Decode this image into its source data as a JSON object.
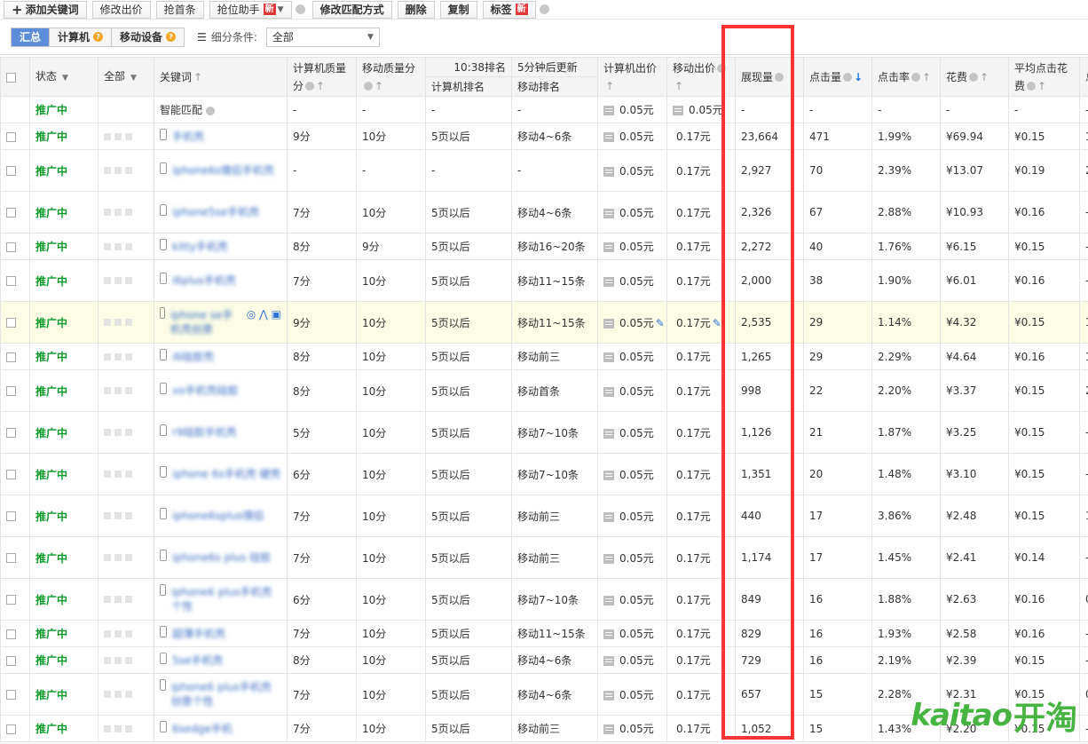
{
  "toolbar": {
    "add_keyword": "添加关键词",
    "modify_bid": "修改出价",
    "grab_first": "抢首条",
    "rank_helper": "抢位助手",
    "new_badge": "新",
    "modify_match": "修改匹配方式",
    "delete": "删除",
    "copy": "复制",
    "tag": "标签"
  },
  "filter": {
    "tabs": [
      "汇总",
      "计算机",
      "移动设备"
    ],
    "condition_label": "细分条件:",
    "condition_value": "全部"
  },
  "headers": {
    "status": "状态",
    "all": "全部",
    "keyword": "关键词",
    "pc_quality": "计算机质量分",
    "mobile_quality": "移动质量分",
    "rank_time": "10:38排名",
    "update_note": "5分钟后更新",
    "pc_rank": "计算机排名",
    "mobile_rank": "移动排名",
    "pc_bid": "计算机出价",
    "mobile_bid": "移动出价",
    "impressions": "展现量",
    "clicks": "点击量",
    "ctr": "点击率",
    "cost": "花费",
    "avg_cpc": "平均点击花费",
    "extra": "总"
  },
  "smart_row": {
    "status": "推广中",
    "keyword": "智能匹配",
    "pc_quality": "-",
    "mobile_quality": "-",
    "pc_rank": "-",
    "mobile_rank": "-",
    "pc_bid": "0.05元",
    "mobile_bid": "0.05元",
    "impressions": "-",
    "clicks": "-",
    "ctr": "-",
    "cost": "-",
    "avg_cpc": "-",
    "extra": "-"
  },
  "rows": [
    {
      "status": "推广中",
      "keyword": "手机壳",
      "pcq": "9分",
      "mq": "10分",
      "pcr": "5页以后",
      "mr": "移动4~6条",
      "pcb": "0.05元",
      "mb": "0.17元",
      "imp": "23,664",
      "clk": "471",
      "ctr": "1.99%",
      "cost": "¥69.94",
      "cpc": "¥0.15",
      "ex": "1"
    },
    {
      "status": "推广中",
      "keyword": "iphone6s情侣手机壳",
      "pcq": "-",
      "mq": "-",
      "pcr": "-",
      "mr": "-",
      "pcb": "0.05元",
      "mb": "0.17元",
      "imp": "2,927",
      "clk": "70",
      "ctr": "2.39%",
      "cost": "¥13.07",
      "cpc": "¥0.19",
      "ex": "2"
    },
    {
      "status": "推广中",
      "keyword": "iphone5se手机壳",
      "pcq": "7分",
      "mq": "10分",
      "pcr": "5页以后",
      "mr": "移动4~6条",
      "pcb": "0.05元",
      "mb": "0.17元",
      "imp": "2,326",
      "clk": "67",
      "ctr": "2.88%",
      "cost": "¥10.93",
      "cpc": "¥0.16",
      "ex": "-"
    },
    {
      "status": "推广中",
      "keyword": "kitty手机壳",
      "pcq": "8分",
      "mq": "9分",
      "pcr": "5页以后",
      "mr": "移动16~20条",
      "pcb": "0.05元",
      "mb": "0.17元",
      "imp": "2,272",
      "clk": "40",
      "ctr": "1.76%",
      "cost": "¥6.15",
      "cpc": "¥0.15",
      "ex": "-"
    },
    {
      "status": "推广中",
      "keyword": "i6plus手机壳",
      "pcq": "7分",
      "mq": "10分",
      "pcr": "5页以后",
      "mr": "移动11~15条",
      "pcb": "0.05元",
      "mb": "0.17元",
      "imp": "2,000",
      "clk": "38",
      "ctr": "1.90%",
      "cost": "¥6.01",
      "cpc": "¥0.16",
      "ex": "-"
    },
    {
      "status": "推广中",
      "keyword": "iphone se手机壳创意",
      "pcq": "9分",
      "mq": "10分",
      "pcr": "5页以后",
      "mr": "移动11~15条",
      "pcb": "0.05元",
      "mb": "0.17元",
      "imp": "2,535",
      "clk": "29",
      "ctr": "1.14%",
      "cost": "¥4.32",
      "cpc": "¥0.15",
      "ex": "1"
    },
    {
      "status": "推广中",
      "keyword": "i6硅胶壳",
      "pcq": "8分",
      "mq": "10分",
      "pcr": "5页以后",
      "mr": "移动前三",
      "pcb": "0.05元",
      "mb": "0.17元",
      "imp": "1,265",
      "clk": "29",
      "ctr": "2.29%",
      "cost": "¥4.64",
      "cpc": "¥0.16",
      "ex": "1"
    },
    {
      "status": "推广中",
      "keyword": "vo手机壳硅胶",
      "pcq": "8分",
      "mq": "10分",
      "pcr": "5页以后",
      "mr": "移动首条",
      "pcb": "0.05元",
      "mb": "0.17元",
      "imp": "998",
      "clk": "22",
      "ctr": "2.20%",
      "cost": "¥3.37",
      "cpc": "¥0.15",
      "ex": "2"
    },
    {
      "status": "推广中",
      "keyword": "r9硅胶手机壳",
      "pcq": "5分",
      "mq": "10分",
      "pcr": "5页以后",
      "mr": "移动7~10条",
      "pcb": "0.05元",
      "mb": "0.17元",
      "imp": "1,126",
      "clk": "21",
      "ctr": "1.87%",
      "cost": "¥3.25",
      "cpc": "¥0.15",
      "ex": "-"
    },
    {
      "status": "推广中",
      "keyword": "iphone 6s手机壳 硬壳",
      "pcq": "6分",
      "mq": "10分",
      "pcr": "5页以后",
      "mr": "移动7~10条",
      "pcb": "0.05元",
      "mb": "0.17元",
      "imp": "1,351",
      "clk": "20",
      "ctr": "1.48%",
      "cost": "¥3.10",
      "cpc": "¥0.15",
      "ex": "-"
    },
    {
      "status": "推广中",
      "keyword": "iphone6splus情侣",
      "pcq": "7分",
      "mq": "10分",
      "pcr": "5页以后",
      "mr": "移动前三",
      "pcb": "0.05元",
      "mb": "0.17元",
      "imp": "440",
      "clk": "17",
      "ctr": "3.86%",
      "cost": "¥2.48",
      "cpc": "¥0.15",
      "ex": "1"
    },
    {
      "status": "推广中",
      "keyword": "iphone6s plus 硅胶",
      "pcq": "7分",
      "mq": "10分",
      "pcr": "5页以后",
      "mr": "移动前三",
      "pcb": "0.05元",
      "mb": "0.17元",
      "imp": "1,174",
      "clk": "17",
      "ctr": "1.45%",
      "cost": "¥2.41",
      "cpc": "¥0.14",
      "ex": "-"
    },
    {
      "status": "推广中",
      "keyword": "iphone6 plus手机壳 个性",
      "pcq": "6分",
      "mq": "10分",
      "pcr": "5页以后",
      "mr": "移动7~10条",
      "pcb": "0.05元",
      "mb": "0.17元",
      "imp": "849",
      "clk": "16",
      "ctr": "1.88%",
      "cost": "¥2.63",
      "cpc": "¥0.16",
      "ex": "0"
    },
    {
      "status": "推广中",
      "keyword": "超薄手机壳",
      "pcq": "7分",
      "mq": "10分",
      "pcr": "5页以后",
      "mr": "移动11~15条",
      "pcb": "0.05元",
      "mb": "0.17元",
      "imp": "829",
      "clk": "16",
      "ctr": "1.93%",
      "cost": "¥2.58",
      "cpc": "¥0.16",
      "ex": "-"
    },
    {
      "status": "推广中",
      "keyword": "5se手机壳",
      "pcq": "8分",
      "mq": "10分",
      "pcr": "5页以后",
      "mr": "移动4~6条",
      "pcb": "0.05元",
      "mb": "0.17元",
      "imp": "729",
      "clk": "16",
      "ctr": "2.19%",
      "cost": "¥2.39",
      "cpc": "¥0.15",
      "ex": "-"
    },
    {
      "status": "推广中",
      "keyword": "iphone6 plus手机壳创意个性",
      "pcq": "7分",
      "mq": "10分",
      "pcr": "5页以后",
      "mr": "移动4~6条",
      "pcb": "0.05元",
      "mb": "0.17元",
      "imp": "657",
      "clk": "15",
      "ctr": "2.28%",
      "cost": "¥2.31",
      "cpc": "¥0.15",
      "ex": "0"
    },
    {
      "status": "推广中",
      "keyword": "6sedge手机",
      "pcq": "7分",
      "mq": "10分",
      "pcr": "5页以后",
      "mr": "移动前三",
      "pcb": "0.05元",
      "mb": "0.17元",
      "imp": "1,052",
      "clk": "15",
      "ctr": "1.43%",
      "cost": "¥2.20",
      "cpc": "¥0.15",
      "ex": "-"
    }
  ],
  "watermark": {
    "latin": "kaitao",
    "cn": "开淘"
  },
  "colors": {
    "status": "#0a9a2a",
    "highlight": "#ff3333",
    "accent": "#5b8dd9",
    "brand": "#47b341"
  }
}
